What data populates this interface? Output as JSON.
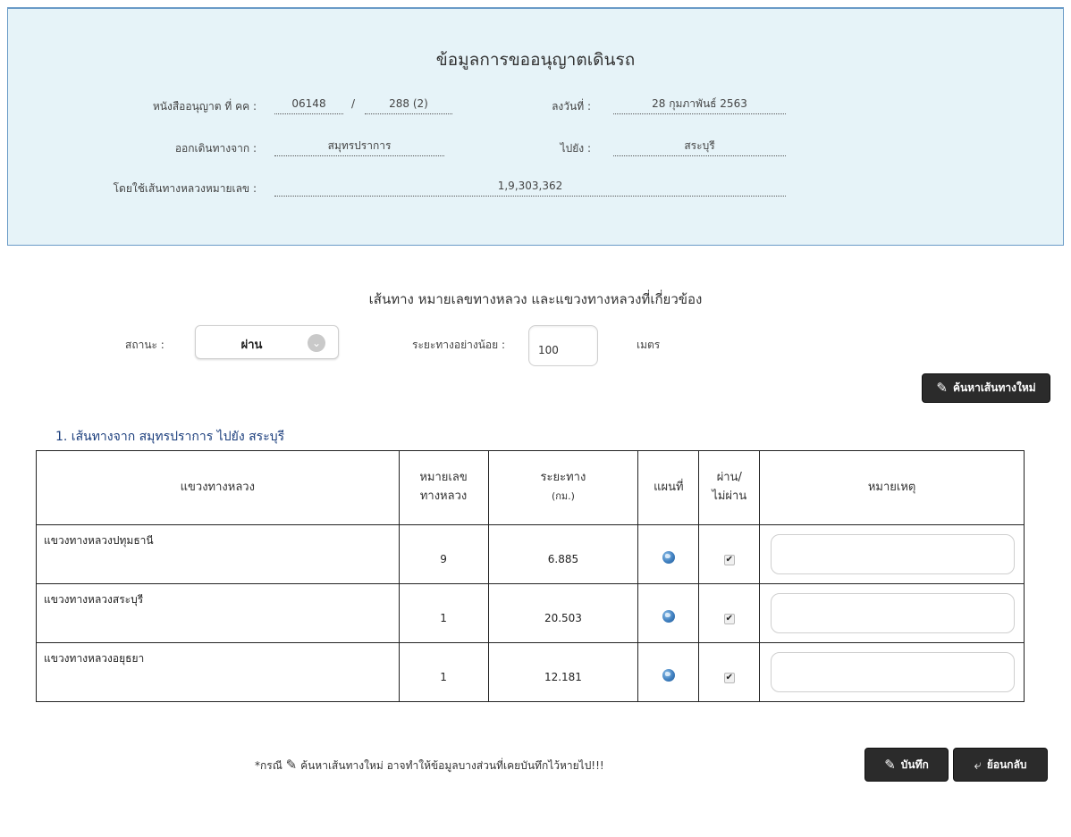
{
  "info": {
    "title": "ข้อมูลการขออนุญาตเดินรถ",
    "permit_label": "หนังสืออนุญาต ที่ คค :",
    "permit_no": "06148",
    "permit_sep": "/",
    "permit_sub": "288 (2)",
    "date_label": "ลงวันที่ :",
    "date_value": "28 กุมภาพันธ์ 2563",
    "from_label": "ออกเดินทางจาก :",
    "from_value": "สมุทรปราการ",
    "to_label": "ไปยัง :",
    "to_value": "สระบุรี",
    "route_label": "โดยใช้เส้นทางหลวงหมายเลข :",
    "route_value": "1,9,303,362"
  },
  "filter": {
    "section_title": "เส้นทาง หมายเลขทางหลวง และแขวงทางหลวงที่เกี่ยวข้อง",
    "status_label": "สถานะ :",
    "status_value": "ผ่าน",
    "distance_label": "ระยะทางอย่างน้อย :",
    "distance_value": "100",
    "distance_unit": "เมตร",
    "search_button": "ค้นหาเส้นทางใหม่"
  },
  "result": {
    "heading": "1. เส้นทางจาก สมุทรปราการ ไปยัง สระบุรี",
    "columns": {
      "district": "แขวงทางหลวง",
      "number_1": "หมายเลข",
      "number_2": "ทางหลวง",
      "distance_1": "ระยะทาง",
      "distance_2": "(กม.)",
      "map": "แผนที่",
      "pass_1": "ผ่าน/",
      "pass_2": "ไม่ผ่าน",
      "note": "หมายเหตุ"
    },
    "rows": [
      {
        "district": "แขวงทางหลวงปทุมธานี",
        "number": "9",
        "distance": "6.885",
        "passed": true
      },
      {
        "district": "แขวงทางหลวงสระบุรี",
        "number": "1",
        "distance": "20.503",
        "passed": true
      },
      {
        "district": "แขวงทางหลวงอยุธยา",
        "number": "1",
        "distance": "12.181",
        "passed": true
      }
    ]
  },
  "footer": {
    "note_prefix": "*กรณี",
    "note_text": "ค้นหาเส้นทางใหม่ อาจทำให้ข้อมูลบางส่วนที่เคยบันทึกไว้หายไป!!!",
    "save_button": "บันทึก",
    "back_button": "ย้อนกลับ"
  },
  "icons": {
    "edit": "edit-icon",
    "back": "reply-arrow-icon",
    "map": "globe-icon",
    "dropdown": "chevron-down-icon"
  }
}
